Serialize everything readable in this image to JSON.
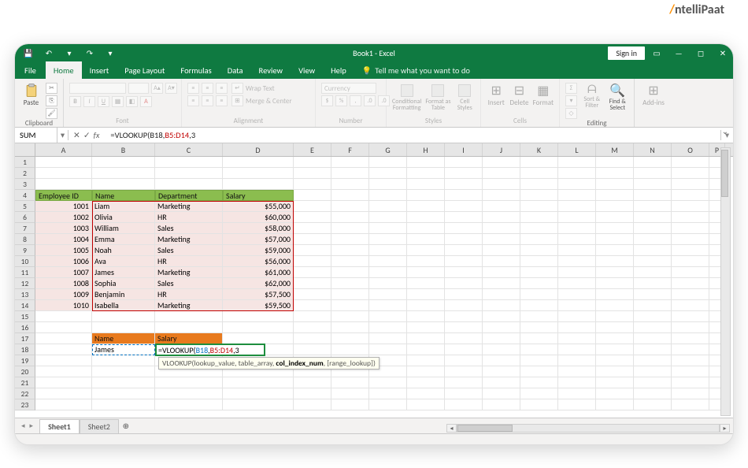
{
  "colors": {
    "ribbon_green": "#0f7a41",
    "header_green": "#8bbd4f",
    "header_orange": "#e87a1e",
    "body_pink": "#f6e5e3"
  },
  "logo": {
    "prefix_orange": "/",
    "text": "ntelliPaat"
  },
  "titlebar": {
    "title": "Book1 - Excel",
    "signin": "Sign in"
  },
  "tabs": {
    "file": "File",
    "items": [
      "Home",
      "Insert",
      "Page Layout",
      "Formulas",
      "Data",
      "Review",
      "View",
      "Help"
    ],
    "active": "Home",
    "tellme": "Tell me what you want to do"
  },
  "ribbon": {
    "clipboard": {
      "label": "Clipboard",
      "paste": "Paste"
    },
    "font": {
      "label": "Font",
      "family": "",
      "size": ""
    },
    "alignment": {
      "label": "Alignment",
      "wrap": "Wrap Text",
      "merge": "Merge & Center"
    },
    "number": {
      "label": "Number",
      "format": "Currency"
    },
    "styles": {
      "label": "Styles",
      "cond": "Conditional Formatting",
      "table": "Format as Table",
      "cell": "Cell Styles"
    },
    "cells": {
      "label": "Cells",
      "insert": "Insert",
      "delete": "Delete",
      "format": "Format"
    },
    "editing": {
      "label": "Editing",
      "sort": "Sort & Filter",
      "find": "Find & Select"
    },
    "addins": {
      "label": "",
      "btn": "Add-ins"
    }
  },
  "formula_bar": {
    "namebox": "SUM",
    "formula_prefix": "=VLOOKUP(",
    "arg1": "B18",
    "arg2": "B5:D14",
    "arg3": "3",
    "tooltip_plain": "VLOOKUP(lookup_value, table_array, ",
    "tooltip_bold": "col_index_num",
    "tooltip_tail": ", [range_lookup])"
  },
  "columns": [
    "A",
    "B",
    "C",
    "D",
    "E",
    "F",
    "G",
    "H",
    "I",
    "J",
    "K",
    "L",
    "M",
    "N",
    "O",
    "P"
  ],
  "row_numbers": [
    1,
    2,
    3,
    4,
    5,
    6,
    7,
    8,
    9,
    10,
    11,
    12,
    13,
    14,
    15,
    16,
    17,
    18,
    19,
    20,
    21,
    22,
    23
  ],
  "employee_table": {
    "headers": {
      "id": "Employee ID",
      "name": "Name",
      "dept": "Department",
      "salary": "Salary"
    },
    "rows": [
      {
        "id": 1001,
        "name": "Liam",
        "dept": "Marketing",
        "salary": "$55,000"
      },
      {
        "id": 1002,
        "name": "Olivia",
        "dept": "HR",
        "salary": "$60,000"
      },
      {
        "id": 1003,
        "name": "William",
        "dept": "Sales",
        "salary": "$58,000"
      },
      {
        "id": 1004,
        "name": "Emma",
        "dept": "Marketing",
        "salary": "$57,000"
      },
      {
        "id": 1005,
        "name": "Noah",
        "dept": "Sales",
        "salary": "$59,000"
      },
      {
        "id": 1006,
        "name": "Ava",
        "dept": "HR",
        "salary": "$56,000"
      },
      {
        "id": 1007,
        "name": "James",
        "dept": "Marketing",
        "salary": "$61,000"
      },
      {
        "id": 1008,
        "name": "Sophia",
        "dept": "Sales",
        "salary": "$62,000"
      },
      {
        "id": 1009,
        "name": "Benjamin",
        "dept": "HR",
        "salary": "$57,500"
      },
      {
        "id": 1010,
        "name": "Isabella",
        "dept": "Marketing",
        "salary": "$59,500"
      }
    ]
  },
  "lookup_block": {
    "headers": {
      "name": "Name",
      "salary": "Salary"
    },
    "name_value": "James",
    "cell_display_prefix": "=VLOOKUP(",
    "cell_arg1": "B18",
    "cell_arg2": "B5:D14",
    "cell_arg3": "3"
  },
  "sheets": {
    "active": "Sheet1",
    "others": [
      "Sheet2"
    ]
  }
}
